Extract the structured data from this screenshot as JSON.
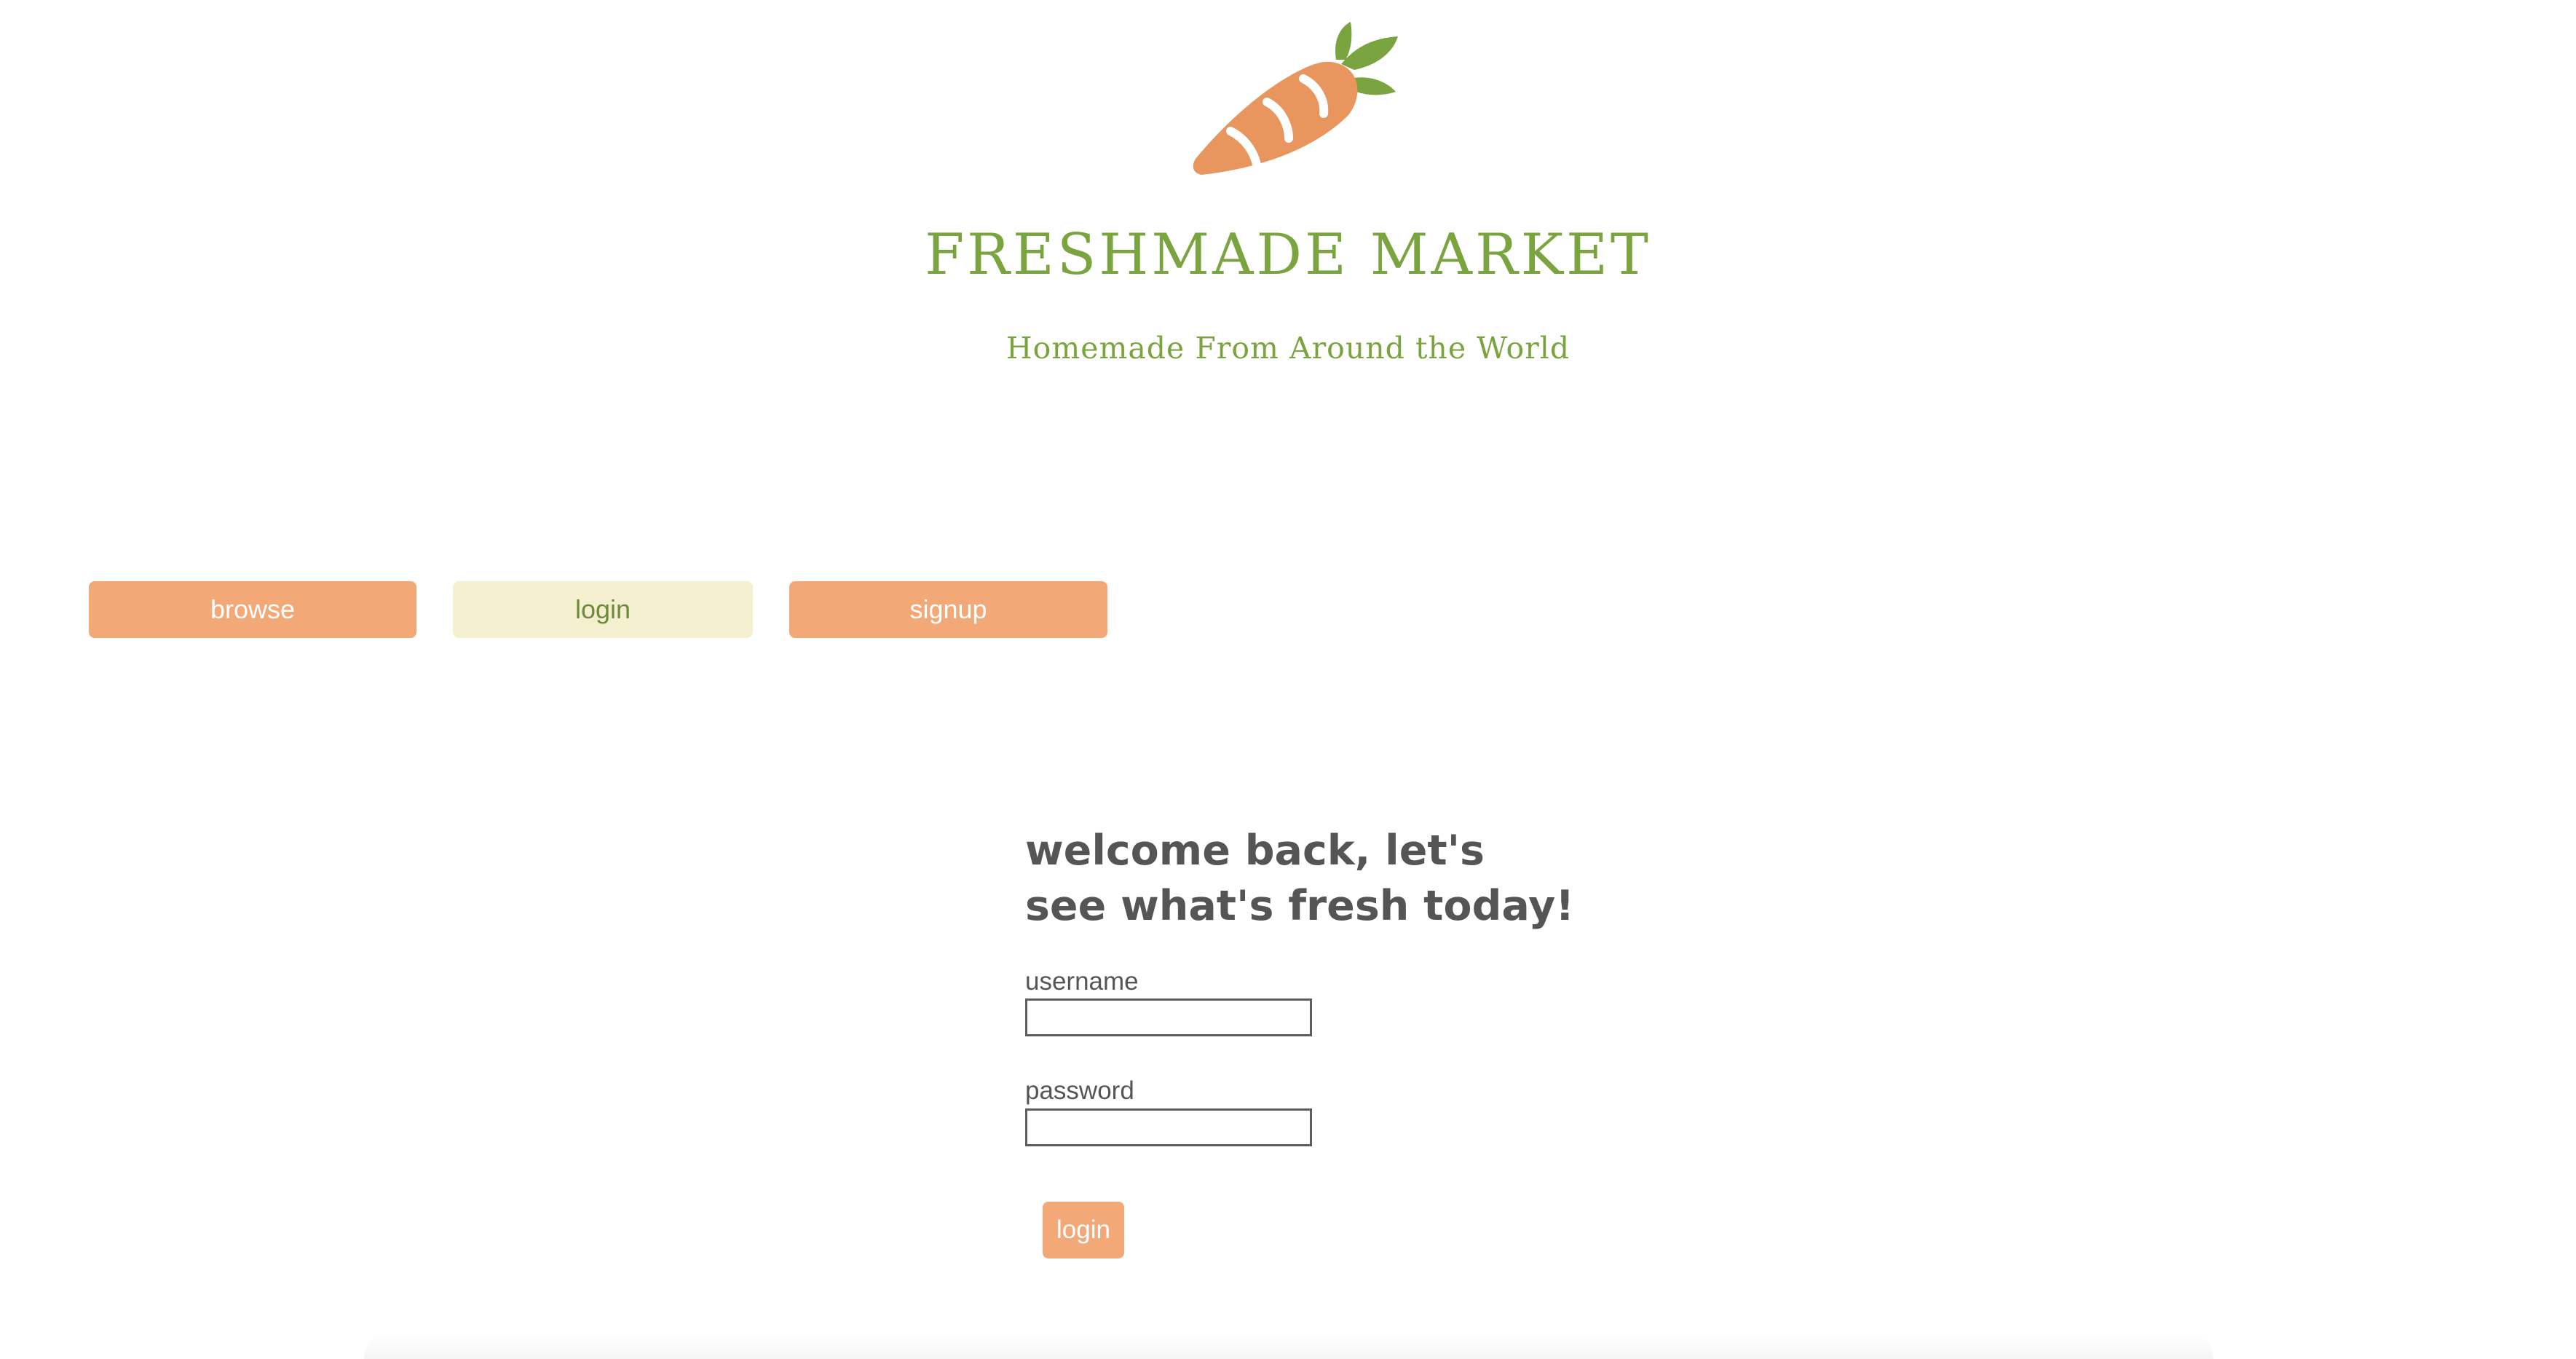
{
  "header": {
    "logo_icon": "carrot-icon",
    "title": "FRESHMADE MARKET",
    "tagline": "Homemade From Around the World"
  },
  "nav": {
    "items": [
      {
        "label": "browse",
        "active": false
      },
      {
        "label": "login",
        "active": true
      },
      {
        "label": "signup",
        "active": false
      }
    ]
  },
  "login_form": {
    "heading": "welcome back, let's see what's fresh today!",
    "username_label": "username",
    "username_value": "",
    "password_label": "password",
    "password_value": "",
    "submit_label": "login"
  },
  "colors": {
    "accent_orange": "#f2a877",
    "accent_green": "#7aa43f",
    "active_tab_bg": "#f4efcf",
    "text_gray": "#555555"
  }
}
